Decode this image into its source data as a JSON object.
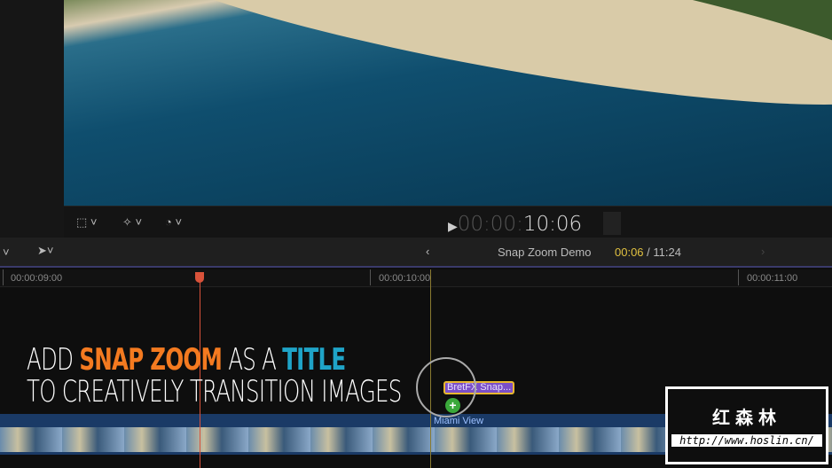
{
  "viewer": {
    "timecode_dim": "00:00:",
    "timecode": "10:06"
  },
  "timeline": {
    "project_name": "Snap Zoom Demo",
    "current": "00:06",
    "separator": "/",
    "duration": "11:24",
    "ruler": [
      "00:00:09:00",
      "00:00:10:00",
      "00:00:11:00"
    ],
    "title_clip": "BretFX Snap...",
    "video_clip": "Miami View"
  },
  "overlay": {
    "line1": [
      "ADD ",
      "SNAP ZOOM",
      " AS A ",
      "TITLE"
    ],
    "line2": "TO CREATIVELY TRANSITION IMAGES"
  },
  "watermark": {
    "name": "红森林",
    "url": "http://www.hoslin.cn/"
  },
  "colors": {
    "accent_orange": "#f47a20",
    "accent_blue": "#1fa4c8",
    "timecode_yellow": "#e0c040",
    "playhead": "#d9523a"
  }
}
